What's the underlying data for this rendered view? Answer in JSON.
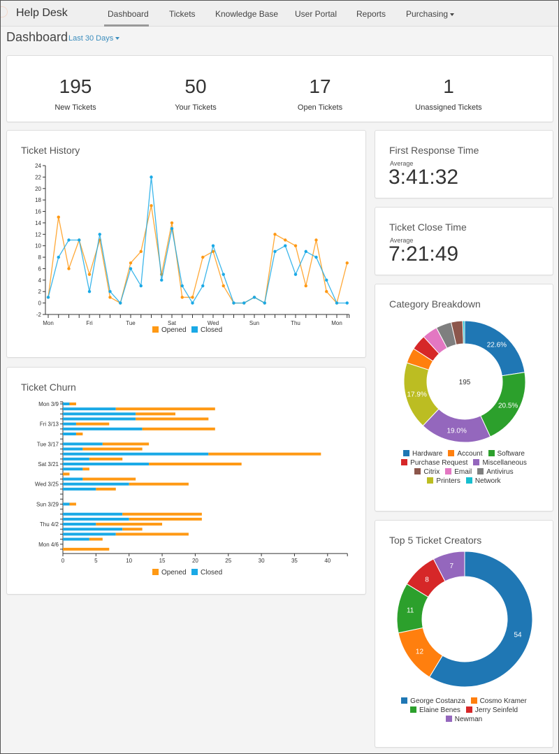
{
  "app": {
    "brand": "Help Desk"
  },
  "nav": {
    "items": [
      {
        "label": "Dashboard",
        "active": true
      },
      {
        "label": "Tickets"
      },
      {
        "label": "Knowledge Base"
      },
      {
        "label": "User Portal"
      },
      {
        "label": "Reports"
      },
      {
        "label": "Purchasing",
        "dropdown": true
      }
    ]
  },
  "page": {
    "title": "Dashboard",
    "range_label": "Last 30 Days"
  },
  "stats": [
    {
      "value": "195",
      "label": "New Tickets"
    },
    {
      "value": "50",
      "label": "Your Tickets"
    },
    {
      "value": "17",
      "label": "Open Tickets"
    },
    {
      "value": "1",
      "label": "Unassigned Tickets"
    }
  ],
  "first_response": {
    "title": "First Response Time",
    "sub": "Average",
    "value": "3:41:32"
  },
  "close_time": {
    "title": "Ticket Close Time",
    "sub": "Average",
    "value": "7:21:49"
  },
  "colors": {
    "opened": "#ff9914",
    "closed": "#1aa9e6"
  },
  "chart_data": [
    {
      "id": "ticket-history",
      "type": "line",
      "title": "Ticket History",
      "xlabel": "",
      "ylabel": "",
      "ylim": [
        -2,
        24
      ],
      "yticks": [
        -2,
        0,
        2,
        4,
        6,
        8,
        10,
        12,
        14,
        16,
        18,
        20,
        22,
        24
      ],
      "x_tick_labels": [
        {
          "index": 0,
          "label": "Mon"
        },
        {
          "index": 4,
          "label": "Fri"
        },
        {
          "index": 8,
          "label": "Tue"
        },
        {
          "index": 12,
          "label": "Sat"
        },
        {
          "index": 16,
          "label": "Wed"
        },
        {
          "index": 20,
          "label": "Sun"
        },
        {
          "index": 24,
          "label": "Thu"
        },
        {
          "index": 28,
          "label": "Mon"
        }
      ],
      "x_count": 30,
      "legend": "bottom",
      "series": [
        {
          "name": "Opened",
          "values": [
            1,
            15,
            6,
            11,
            5,
            11,
            1,
            0,
            7,
            9,
            17,
            5,
            14,
            1,
            1,
            8,
            9,
            3,
            0,
            0,
            1,
            0,
            12,
            11,
            10,
            3,
            11,
            2,
            0,
            7
          ]
        },
        {
          "name": "Closed",
          "values": [
            1,
            8,
            11,
            11,
            2,
            12,
            2,
            0,
            6,
            3,
            22,
            4,
            13,
            3,
            0,
            3,
            10,
            5,
            0,
            0,
            1,
            0,
            9,
            10,
            5,
            9,
            8,
            4,
            0,
            0
          ]
        }
      ]
    },
    {
      "id": "ticket-churn",
      "type": "bar",
      "orientation": "horizontal",
      "stacked": true,
      "title": "Ticket Churn",
      "xlim": [
        0,
        43
      ],
      "xticks": [
        0,
        5,
        10,
        15,
        20,
        25,
        30,
        35,
        40
      ],
      "row_labels": [
        {
          "index": 0,
          "label": "Mon 3/9"
        },
        {
          "index": 4,
          "label": "Fri 3/13"
        },
        {
          "index": 8,
          "label": "Tue 3/17"
        },
        {
          "index": 12,
          "label": "Sat 3/21"
        },
        {
          "index": 16,
          "label": "Wed 3/25"
        },
        {
          "index": 20,
          "label": "Sun 3/29"
        },
        {
          "index": 24,
          "label": "Thu 4/2"
        },
        {
          "index": 28,
          "label": "Mon 4/6"
        }
      ],
      "legend": "bottom",
      "series": [
        {
          "name": "Closed",
          "values": [
            1,
            8,
            11,
            11,
            2,
            12,
            2,
            0,
            6,
            3,
            22,
            4,
            13,
            3,
            0,
            3,
            10,
            5,
            0,
            0,
            1,
            0,
            9,
            10,
            5,
            9,
            8,
            4,
            0,
            0
          ]
        },
        {
          "name": "Opened",
          "values": [
            1,
            15,
            6,
            11,
            5,
            11,
            1,
            0,
            7,
            9,
            17,
            5,
            14,
            1,
            1,
            8,
            9,
            3,
            0,
            0,
            1,
            0,
            12,
            11,
            10,
            3,
            11,
            2,
            0,
            7
          ]
        }
      ]
    },
    {
      "id": "category-breakdown",
      "type": "pie",
      "donut": true,
      "title": "Category Breakdown",
      "center_label": "195",
      "slices": [
        {
          "label": "Hardware",
          "value": 44,
          "display": "22.6%",
          "color": "#1f77b4"
        },
        {
          "label": "Software",
          "value": 40,
          "display": "20.5%",
          "color": "#2ca02c"
        },
        {
          "label": "Miscellaneous",
          "value": 37,
          "display": "19.0%",
          "color": "#9467bd"
        },
        {
          "label": "Printers",
          "value": 35,
          "display": "17.9%",
          "color": "#bcbd22"
        },
        {
          "label": "Account",
          "value": 8,
          "display": "",
          "color": "#ff7f0e"
        },
        {
          "label": "Purchase Request",
          "value": 8,
          "display": "",
          "color": "#d62728"
        },
        {
          "label": "Email",
          "value": 8,
          "display": "",
          "color": "#e377c2"
        },
        {
          "label": "Antivirus",
          "value": 8,
          "display": "",
          "color": "#7f7f7f"
        },
        {
          "label": "Citrix",
          "value": 6,
          "display": "",
          "color": "#8c564b"
        },
        {
          "label": "Network",
          "value": 1,
          "display": "",
          "color": "#17becf"
        }
      ],
      "legend_rows": [
        [
          "Hardware",
          "Account",
          "Software"
        ],
        [
          "Purchase Request",
          "Miscellaneous"
        ],
        [
          "Citrix",
          "Email",
          "Antivirus"
        ],
        [
          "Printers",
          "Network"
        ]
      ]
    },
    {
      "id": "top-creators",
      "type": "pie",
      "donut": true,
      "title": "Top 5 Ticket Creators",
      "slices": [
        {
          "label": "George Costanza",
          "value": 54,
          "display": "54",
          "color": "#1f77b4"
        },
        {
          "label": "Cosmo Kramer",
          "value": 12,
          "display": "12",
          "color": "#ff7f0e"
        },
        {
          "label": "Elaine Benes",
          "value": 11,
          "display": "11",
          "color": "#2ca02c"
        },
        {
          "label": "Jerry Seinfeld",
          "value": 8,
          "display": "8",
          "color": "#d62728"
        },
        {
          "label": "Newman",
          "value": 7,
          "display": "7",
          "color": "#9467bd"
        }
      ],
      "legend_rows": [
        [
          "George Costanza",
          "Cosmo Kramer"
        ],
        [
          "Elaine Benes",
          "Jerry Seinfeld"
        ],
        [
          "Newman"
        ]
      ]
    }
  ]
}
